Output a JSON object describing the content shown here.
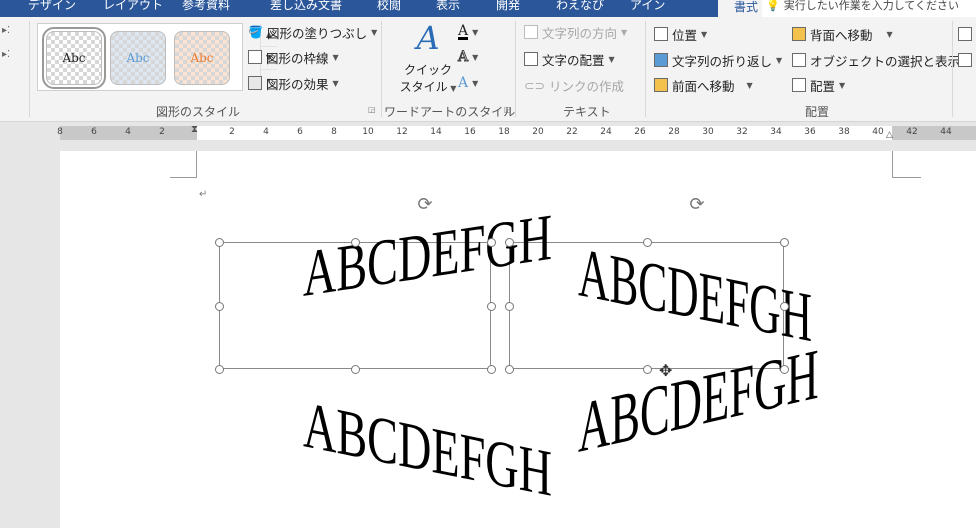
{
  "tabs": [
    "デザイン",
    "レイアウト",
    "参考資料",
    "差し込み文書",
    "校閲",
    "表示",
    "開発",
    "わえなび",
    "アイン",
    "書式"
  ],
  "active_tab": "書式",
  "tell_me": "実行したい作業を入力してください",
  "groups": {
    "shape_styles": {
      "label": "図形のスタイル",
      "gallery": [
        "Abc",
        "Abc",
        "Abc"
      ],
      "fill": "図形の塗りつぶし",
      "outline": "図形の枠線",
      "effects": "図形の効果"
    },
    "wordart_styles": {
      "label": "ワードアートのスタイル",
      "quick": "クイック",
      "quick2": "スタイル"
    },
    "text": {
      "label": "テキスト",
      "direction": "文字列の方向",
      "align": "文字の配置",
      "link": "リンクの作成"
    },
    "arrange": {
      "label": "配置",
      "position": "位置",
      "wrap": "文字列の折り返し",
      "forward": "前面へ移動",
      "backward": "背面へ移動",
      "selection_pane": "オブジェクトの選択と表示",
      "align": "配置"
    }
  },
  "ruler": {
    "labels": [
      "8",
      "6",
      "4",
      "2",
      "2",
      "4",
      "6",
      "8",
      "10",
      "12",
      "14",
      "16",
      "18",
      "20",
      "22",
      "24",
      "26",
      "28",
      "30",
      "32",
      "34",
      "36",
      "38",
      "40",
      "42",
      "44"
    ]
  },
  "document": {
    "paragraph_mark": "↵",
    "wordart": [
      "ABCDEFGH",
      "ABCDEFGH",
      "ABCDEFGH",
      "ABCDEFGH"
    ]
  },
  "colors": {
    "accent": "#2b579a",
    "ribbon": "#f3f3f3",
    "page": "#ffffff"
  }
}
